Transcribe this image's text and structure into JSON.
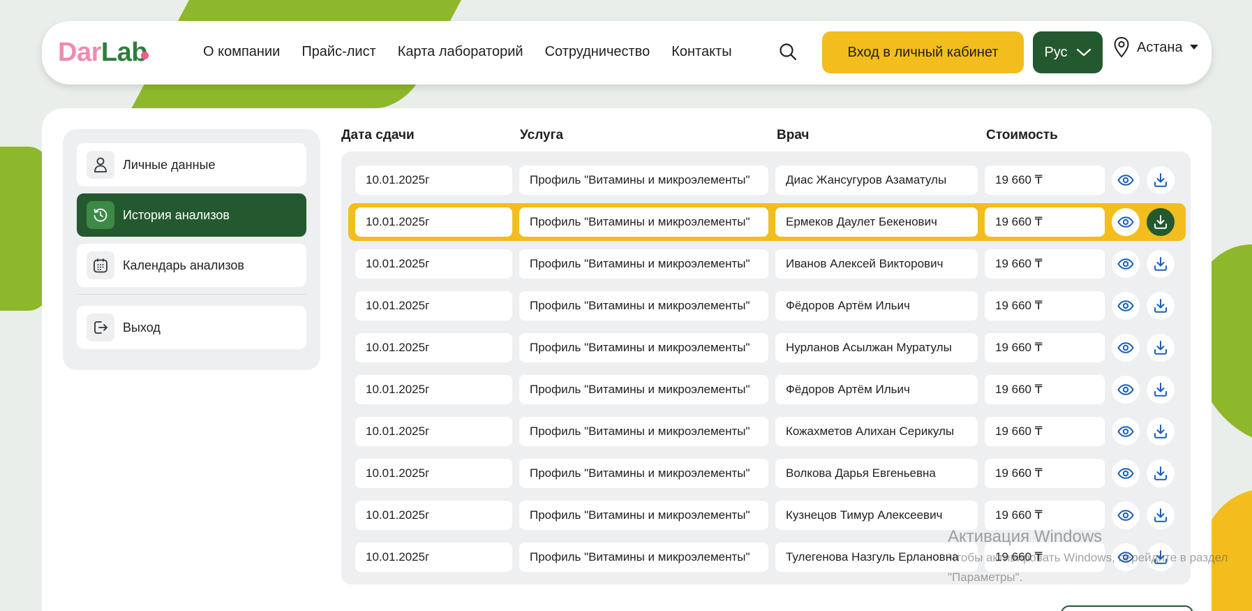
{
  "colors": {
    "brand_green": "#24592f",
    "accent_yellow": "#f2bd1d",
    "logo_pink": "#ee8bb0",
    "logo_green": "#2f7d39",
    "icon_blue": "#1a5fb4"
  },
  "header": {
    "logo_dar": "Dar",
    "logo_lab": "Lab",
    "nav": [
      "О компании",
      "Прайс-лист",
      "Карта лабораторий",
      "Сотрудничество",
      "Контакты"
    ],
    "login_label": "Вход в личный кабинет",
    "lang_label": "Рус",
    "city_label": "Астана"
  },
  "sidebar": {
    "items": [
      {
        "label": "Личные данные",
        "icon": "user-icon"
      },
      {
        "label": "История анализов",
        "icon": "history-icon",
        "active": true
      },
      {
        "label": "Календарь анализов",
        "icon": "calendar-icon"
      },
      {
        "label": "Выход",
        "icon": "logout-icon"
      }
    ]
  },
  "table": {
    "headers": [
      "Дата сдачи",
      "Услуга",
      "Врач",
      "Стоимость"
    ],
    "rows": [
      {
        "date": "10.01.2025г",
        "service": "Профиль \"Витамины и микроэлементы\"",
        "doctor": "Диас Жансугуров Азаматулы",
        "price": "19 660 ₸"
      },
      {
        "date": "10.01.2025г",
        "service": "Профиль \"Витамины и микроэлементы\"",
        "doctor": "Ермеков Даулет Бекенович",
        "price": "19 660 ₸",
        "highlighted": true
      },
      {
        "date": "10.01.2025г",
        "service": "Профиль \"Витамины и микроэлементы\"",
        "doctor": "Иванов Алексей Викторович",
        "price": "19 660 ₸"
      },
      {
        "date": "10.01.2025г",
        "service": "Профиль \"Витамины и микроэлементы\"",
        "doctor": "Фёдоров Артём Ильич",
        "price": "19 660 ₸"
      },
      {
        "date": "10.01.2025г",
        "service": "Профиль \"Витамины и микроэлементы\"",
        "doctor": "Нурланов Асылжан Муратулы",
        "price": "19 660 ₸"
      },
      {
        "date": "10.01.2025г",
        "service": "Профиль \"Витамины и микроэлементы\"",
        "doctor": "Фёдоров Артём Ильич",
        "price": "19 660 ₸"
      },
      {
        "date": "10.01.2025г",
        "service": "Профиль \"Витамины и микроэлементы\"",
        "doctor": "Кожахметов Алихан Серикулы",
        "price": "19 660 ₸"
      },
      {
        "date": "10.01.2025г",
        "service": "Профиль \"Витамины и микроэлементы\"",
        "doctor": "Волкова Дарья Евгеньевна",
        "price": "19 660 ₸"
      },
      {
        "date": "10.01.2025г",
        "service": "Профиль \"Витамины и микроэлементы\"",
        "doctor": "Кузнецов Тимур Алексеевич",
        "price": "19 660 ₸"
      },
      {
        "date": "10.01.2025г",
        "service": "Профиль \"Витамины и микроэлементы\"",
        "doctor": "Тулегенова Назгуль Ерлановна",
        "price": "19 660 ₸"
      }
    ]
  },
  "watermark": {
    "title": "Активация Windows",
    "line1": "Чтобы активировать Windows, перейдите в раздел",
    "line2": "\"Параметры\"."
  }
}
